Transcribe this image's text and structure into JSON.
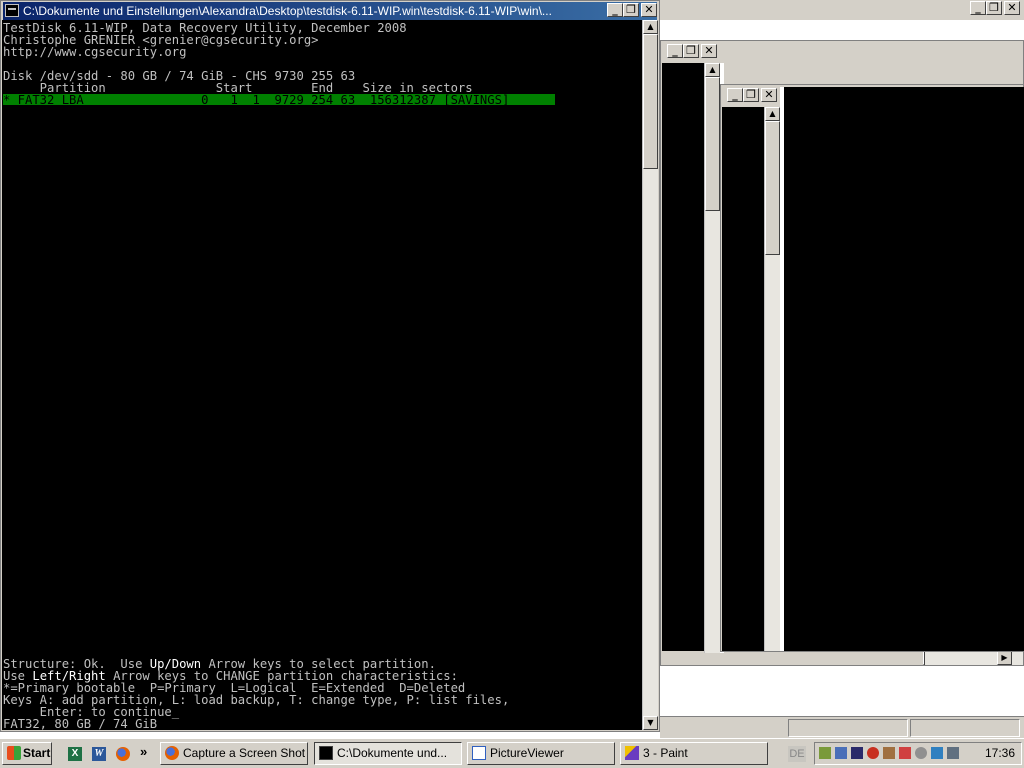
{
  "console": {
    "title": "C:\\Dokumente und Einstellungen\\Alexandra\\Desktop\\testdisk-6.11-WIP.win\\testdisk-6.11-WIP\\win\\...",
    "header_lines": [
      "TestDisk 6.11-WIP, Data Recovery Utility, December 2008",
      "Christophe GRENIER <grenier@cgsecurity.org>",
      "http://www.cgsecurity.org"
    ],
    "disk_line": "Disk /dev/sdd - 80 GB / 74 GiB - CHS 9730 255 63",
    "table_header": "     Partition               Start        End    Size in sectors",
    "selected_row": "* FAT32 LBA                0   1  1  9729 254 63  156312387 [SAVINGS]",
    "footer": {
      "structure_prefix": "Structure: Ok.  Use ",
      "updown": "Up/Down",
      "structure_suffix": " Arrow keys to select partition.",
      "use_prefix": "Use ",
      "leftright": "Left/Right",
      "use_suffix": " Arrow keys to CHANGE partition characteristics:",
      "legend": "*=Primary bootable  P=Primary  L=Logical  E=Extended  D=Deleted",
      "keys_line": "Keys A: add partition, L: load backup, T: change type, P: list files,",
      "enter_line": "     Enter: to continue",
      "cursor": "_",
      "status": "FAT32, 80 GB / 74 GiB"
    }
  },
  "title_buttons": {
    "minimize": "_",
    "restore": "❐",
    "close": "✕"
  },
  "scroll_arrows": {
    "up": "▲",
    "down": "▼",
    "left": "◀",
    "right": "▶"
  },
  "taskbar": {
    "start_label": "Start",
    "more_chevron": "»",
    "buttons": [
      {
        "label": "Capture a Screen Shot ...",
        "icon": "firefox-icon"
      },
      {
        "label": "C:\\Dokumente und...",
        "icon": "console-icon",
        "active": true
      },
      {
        "label": "PictureViewer",
        "icon": "picture-viewer-icon"
      },
      {
        "label": "3 - Paint",
        "icon": "paint-icon"
      }
    ],
    "language": "DE",
    "clock": "17:36"
  },
  "colors": {
    "titlebar_active": "#0a246a",
    "selection_green": "#008000",
    "terminal_bg": "#000000",
    "terminal_fg": "#c0c0c0"
  }
}
